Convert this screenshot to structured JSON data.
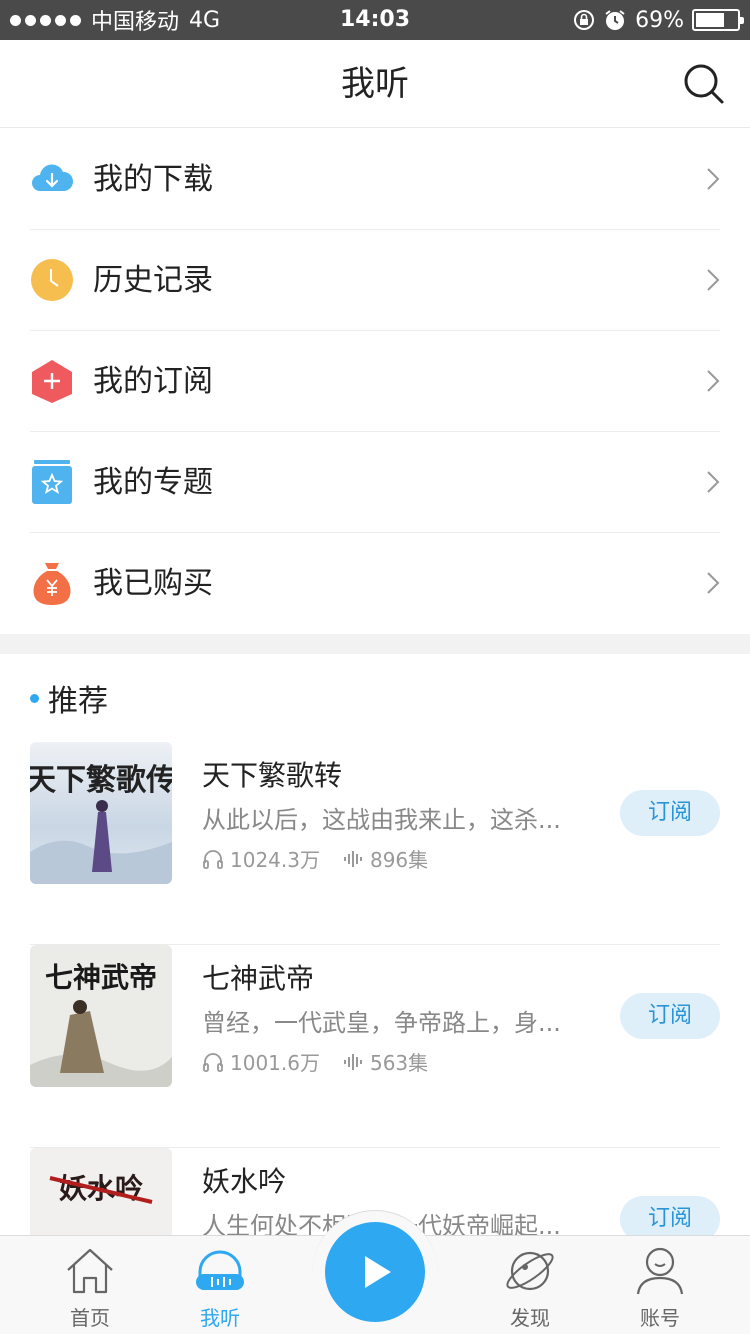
{
  "status_bar": {
    "carrier": "中国移动",
    "network": "4G",
    "time": "14:03",
    "battery_text": "69%",
    "battery_level": 0.69
  },
  "navbar": {
    "title": "我听",
    "search_icon": "search-icon"
  },
  "menu": [
    {
      "label": "我的下载",
      "icon": "download-cloud-icon",
      "color": "#4fb3ef"
    },
    {
      "label": "历史记录",
      "icon": "clock-icon",
      "color": "#f6bd4f"
    },
    {
      "label": "我的订阅",
      "icon": "plus-icon",
      "color": "#ef5a5f"
    },
    {
      "label": "我的专题",
      "icon": "star-folder-icon",
      "color": "#4fb3ef"
    },
    {
      "label": "我已购买",
      "icon": "money-bag-icon",
      "color": "#f36f45"
    }
  ],
  "recommend": {
    "title": "推荐",
    "books": [
      {
        "title": "天下繁歌转",
        "desc": "从此以后，这战由我来止，这杀...",
        "plays": "1024.3万",
        "episodes": "896集",
        "subscribe": "订阅",
        "cover_text": "天下繁歌传"
      },
      {
        "title": "七神武帝",
        "desc": "曾经，一代武皇，争帝路上，身...",
        "plays": "1001.6万",
        "episodes": "563集",
        "subscribe": "订阅",
        "cover_text": "七神武帝"
      },
      {
        "title": "妖水吟",
        "desc": "人生何处不相逢，一代妖帝崛起...",
        "plays": "",
        "episodes": "",
        "subscribe": "订阅",
        "cover_text": "妖水吟"
      }
    ]
  },
  "tabbar": {
    "tabs": [
      {
        "label": "首页",
        "icon": "home-icon"
      },
      {
        "label": "我听",
        "icon": "headphones-icon",
        "active": true
      },
      {
        "label": "发现",
        "icon": "planet-icon"
      },
      {
        "label": "账号",
        "icon": "user-icon"
      }
    ],
    "play_icon": "play-icon"
  },
  "colors": {
    "accent": "#2ea8f0",
    "status_bar_bg": "#4a4a4a",
    "subscribe_bg": "#deeffa",
    "subscribe_text": "#2a94d9"
  }
}
